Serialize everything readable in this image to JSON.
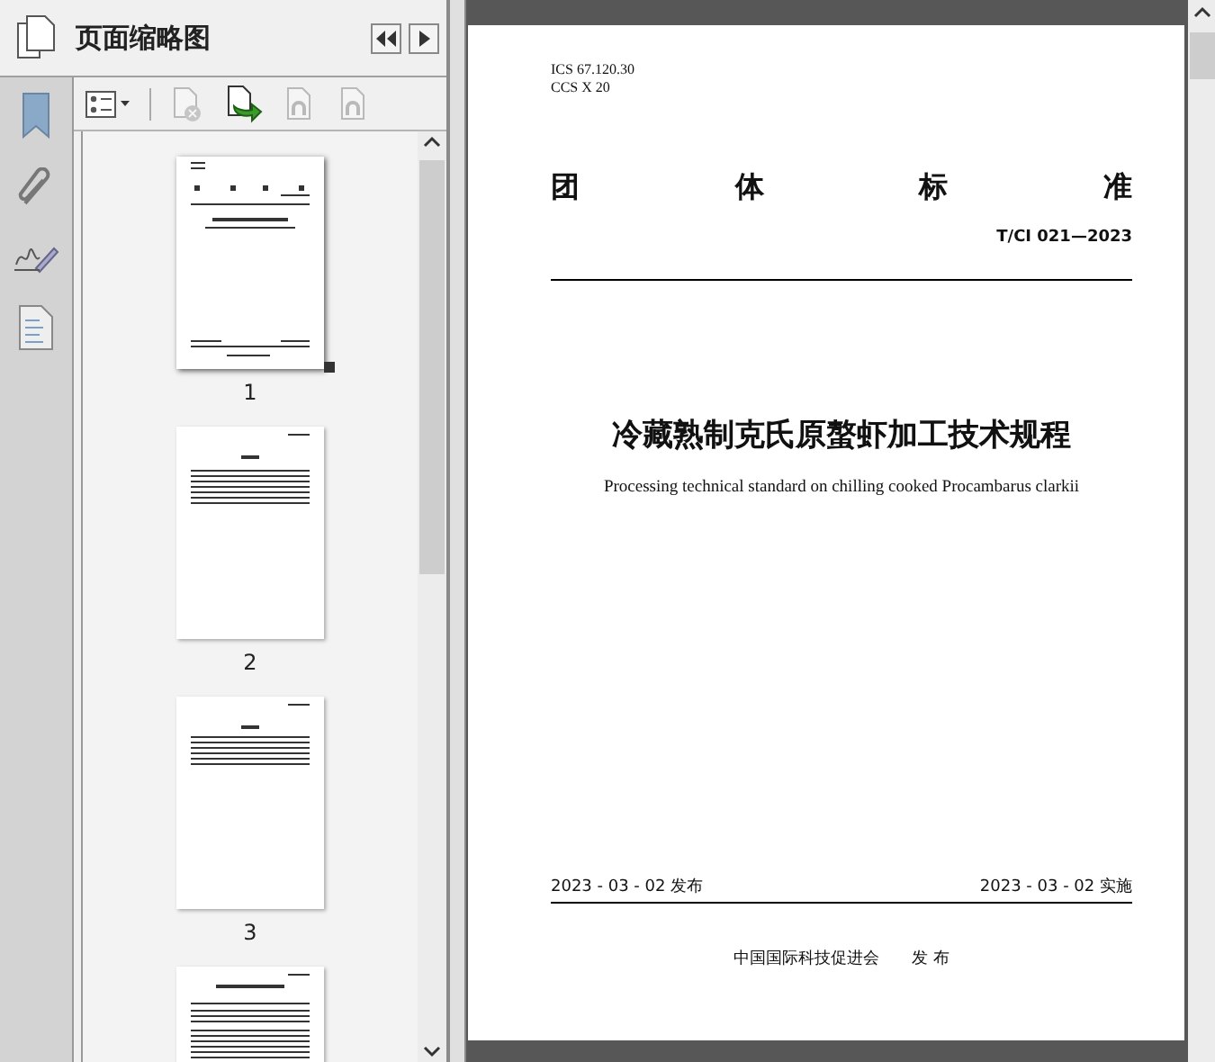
{
  "panel": {
    "title": "页面缩略图"
  },
  "toolbar": [
    {
      "kind": "options",
      "disabled": false
    },
    {
      "kind": "delete",
      "disabled": true
    },
    {
      "kind": "insert",
      "disabled": false
    },
    {
      "kind": "undo",
      "disabled": true
    },
    {
      "kind": "redo",
      "disabled": true
    }
  ],
  "thumbnails": [
    {
      "kind": "cover",
      "label": "1",
      "selected": true
    },
    {
      "kind": "contents",
      "label": "2",
      "selected": false
    },
    {
      "kind": "foreword",
      "label": "3",
      "selected": false
    },
    {
      "kind": "body"
    }
  ],
  "document": {
    "ics": "ICS  67.120.30",
    "ccs": "CCS  X 20",
    "category": [
      "团",
      "体",
      "标",
      "准"
    ],
    "code": "T/CI  021—2023",
    "title": "冷藏熟制克氏原螯虾加工技术规程",
    "subtitle": "Processing technical standard on chilling cooked Procambarus clarkii",
    "issued": "2023 - 03 - 02 发布",
    "effective": "2023 - 03 - 02 实施",
    "publisher": "中国国际科技促进会",
    "publish_word": "发 布"
  }
}
